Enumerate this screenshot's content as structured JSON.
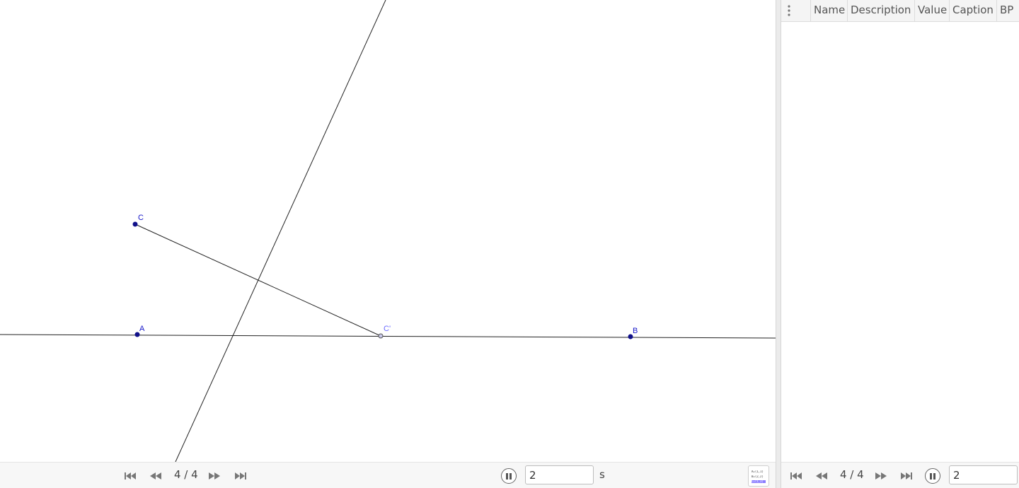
{
  "graphics": {
    "points": [
      {
        "name": "A",
        "label": "A",
        "color": "#1515c8"
      },
      {
        "name": "B",
        "label": "B",
        "color": "#1515c8"
      },
      {
        "name": "C",
        "label": "C",
        "color": "#1515c8"
      },
      {
        "name": "C'",
        "label": "C'",
        "color": "#6a6aff"
      }
    ],
    "nav": {
      "counter": "4 / 4",
      "speed": "2",
      "unit": "s"
    },
    "toggle_icon": {
      "lines": [
        "A=(1,1)",
        "B=(2,2)",
        "C=(1,3)"
      ]
    }
  },
  "construction_protocol": {
    "columns": [
      "Name",
      "Description",
      "Value",
      "Caption",
      "BP"
    ],
    "rows": [],
    "nav": {
      "counter": "4 / 4",
      "speed": "2"
    }
  }
}
